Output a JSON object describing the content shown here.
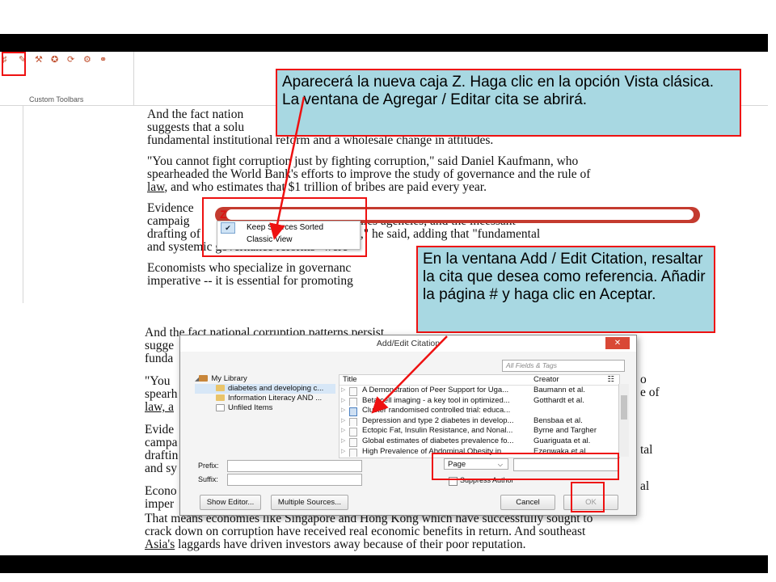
{
  "ribbon": {
    "caption": "Custom Toolbars",
    "icons": [
      "zotero-insert-citation-icon",
      "zotero-insert-bibliography-icon",
      "zotero-edit-citation-icon",
      "zotero-edit-bibliography-icon",
      "zotero-refresh-icon",
      "zotero-preferences-icon",
      "zotero-unlink-icon"
    ]
  },
  "doc_top": {
    "p1": [
      "And the fact nation",
      "suggests that a solu",
      "fundamental institutional reform and a wholesale change in attitudes."
    ],
    "p2_line1": "\"You cannot fight corruption just by fighting corruption,\" said Daniel Kaufmann, who",
    "p2_line2": "spearheaded the World Bank's efforts to improve the study of governance and the rule of",
    "p2_line3_u": "law",
    "p2_line3_rest": ", and who estimates that $1 trillion of bribes are paid every year.",
    "p3": [
      "Evidence",
      "campaig                      commissions and ethics agencies, and the incessant",
      "drafting of                     d codes of conduct,\" he said, adding that \"fundamental",
      "and systemic governance reforms\" were"
    ],
    "p4": [
      "Economists who specialize in governanc                                                          al",
      "imperative -- it is essential for promoting"
    ]
  },
  "doc_bottom": {
    "p1": [
      "And the fact national corruption patterns persist",
      "sugge",
      "funda"
    ],
    "p2": [
      "\"You",
      "spearh",
      "law, a"
    ],
    "p2_right": [
      "o",
      "e of"
    ],
    "p3": [
      "Evide",
      "campa",
      "draftin",
      "and sy"
    ],
    "p3_right": "tal",
    "p4": [
      "Econo",
      "imper"
    ],
    "p4_right": "al",
    "p5_line1": "That means economies like Singapore and Hong Kong which have successfully sought to",
    "p5_line2": "crack down on corruption have received real economic benefits in return. And southeast",
    "p5_line3_u": "Asia's",
    "p5_line3_rest": " laggards have driven investors away because of their poor reputation."
  },
  "callout1": {
    "text": "Aparecerá la nueva caja Z. Haga clic en la opción Vista clásica. La ventana de Agregar / Editar cita se abrirá."
  },
  "callout2": {
    "text": "En la ventana Add / Edit Citation, resaltar la cita que desea como referencia. Añadir la página # y haga clic en Aceptar."
  },
  "zbox": {
    "logo": "Z",
    "menu": [
      {
        "label": "Keep Sources Sorted",
        "checked": true
      },
      {
        "label": "Classic View",
        "checked": false
      }
    ]
  },
  "dialog": {
    "title": "Add/Edit Citation",
    "search_placeholder": "All Fields & Tags",
    "tree": {
      "root": "My Library",
      "items": [
        "diabetes and developing c...",
        "Information Literacy AND ...",
        "Unfiled Items"
      ]
    },
    "columns": {
      "title": "Title",
      "creator": "Creator"
    },
    "rows": [
      {
        "title": "A Demonstration of Peer Support for Uga...",
        "creator": "Baumann et al."
      },
      {
        "title": "Beta cell imaging - a key tool in optimized...",
        "creator": "Gotthardt et al."
      },
      {
        "title": "Cluster randomised controlled trial: educa...",
        "creator": ""
      },
      {
        "title": "Depression and type 2 diabetes in develop...",
        "creator": "Bensbaa et al."
      },
      {
        "title": "Ectopic Fat, Insulin Resistance, and Nonal...",
        "creator": "Byrne and Targher"
      },
      {
        "title": "Global estimates of diabetes prevalence fo...",
        "creator": "Guariguata et al."
      },
      {
        "title": "High Prevalence of Abdominal Obesity in...",
        "creator": "Ezenwaka et al."
      }
    ],
    "prefix_label": "Prefix:",
    "suffix_label": "Suffix:",
    "locator_type": "Page",
    "suppress_author": "Suppress Author",
    "show_editor": "Show Editor...",
    "multiple_sources": "Multiple Sources...",
    "cancel": "Cancel",
    "ok": "OK"
  },
  "colors": {
    "callout_bg": "#a8d8e2",
    "highlight_red": "#ee1111",
    "zotero_red": "#c43b2f"
  }
}
